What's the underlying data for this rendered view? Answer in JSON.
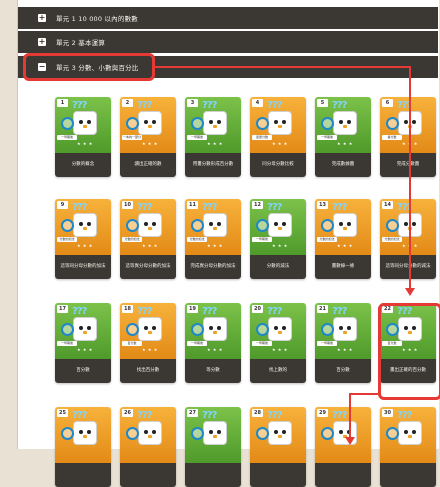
{
  "units": [
    {
      "label": "單元 1 10 000 以內的數數",
      "icon": "plus-toggle-icon",
      "toggle": "+"
    },
    {
      "label": "單元 2 基本運算",
      "icon": "plus-toggle-icon",
      "toggle": "+"
    },
    {
      "label": "單元 3 分數、小數與百分比",
      "icon": "minus-toggle-icon",
      "toggle": "−"
    }
  ],
  "annotation_color": "#e53935",
  "card_qmarks": "???",
  "cards": [
    {
      "num": "1",
      "color": "green",
      "sub": "一學期後",
      "stars": "★ ★ ★",
      "title": "分數的概念"
    },
    {
      "num": "2",
      "color": "orange",
      "sub": "一本的一部分",
      "stars": "★ ★ ★",
      "title": "讀出正確的數"
    },
    {
      "num": "3",
      "color": "green",
      "sub": "一學期後",
      "stars": "★ ★ ★",
      "title": "用畫分數形成百分數"
    },
    {
      "num": "4",
      "color": "orange",
      "sub": "單量分數",
      "stars": "★ ★ ★",
      "title": "同分母分數比較"
    },
    {
      "num": "5",
      "color": "green",
      "sub": "一學期後",
      "stars": "★ ★ ★",
      "title": "完成數據圖"
    },
    {
      "num": "6",
      "color": "orange",
      "sub": "畫分數",
      "stars": "★ ★ ★",
      "title": "完成分數圖"
    },
    {
      "num": "9",
      "color": "orange",
      "sub": "分數的加法",
      "stars": "★ ★ ★",
      "title": "這等同分母分數的加法"
    },
    {
      "num": "10",
      "color": "orange",
      "sub": "分數的加法",
      "stars": "★ ★ ★",
      "title": "這等異分母分數的加法"
    },
    {
      "num": "11",
      "color": "orange",
      "sub": "分數的加法",
      "stars": "★ ★ ★",
      "title": "完成異分母分數的加法"
    },
    {
      "num": "12",
      "color": "green",
      "sub": "一學期後",
      "stars": "★ ★ ★",
      "title": "分數的減法"
    },
    {
      "num": "13",
      "color": "orange",
      "sub": "分數的加法",
      "stars": "★ ★ ★",
      "title": "畫數線一條"
    },
    {
      "num": "14",
      "color": "orange",
      "sub": "分數的加法",
      "stars": "★ ★ ★",
      "title": "這等同分母分數的減法"
    },
    {
      "num": "17",
      "color": "green",
      "sub": "一學期後",
      "stars": "★ ★ ★",
      "title": "百分數"
    },
    {
      "num": "18",
      "color": "orange",
      "sub": "百分數",
      "stars": "★ ★ ★",
      "title": "找出百分數"
    },
    {
      "num": "19",
      "color": "green",
      "sub": "一學期後",
      "stars": "★ ★ ★",
      "title": "等分數"
    },
    {
      "num": "20",
      "color": "green",
      "sub": "一學期後",
      "stars": "★ ★ ★",
      "title": "找上數的"
    },
    {
      "num": "21",
      "color": "green",
      "sub": "一學期後",
      "stars": "★ ★ ★",
      "title": "百分數"
    },
    {
      "num": "22",
      "color": "green",
      "sub": "百分數",
      "stars": "★ ★ ★",
      "title": "畫出正確的百分數"
    },
    {
      "num": "25",
      "color": "orange",
      "sub": "",
      "stars": "",
      "title": ""
    },
    {
      "num": "26",
      "color": "orange",
      "sub": "",
      "stars": "",
      "title": ""
    },
    {
      "num": "27",
      "color": "green",
      "sub": "",
      "stars": "",
      "title": ""
    },
    {
      "num": "28",
      "color": "orange",
      "sub": "",
      "stars": "",
      "title": ""
    },
    {
      "num": "29",
      "color": "orange",
      "sub": "",
      "stars": "",
      "title": ""
    },
    {
      "num": "30",
      "color": "orange",
      "sub": "",
      "stars": "",
      "title": ""
    }
  ]
}
